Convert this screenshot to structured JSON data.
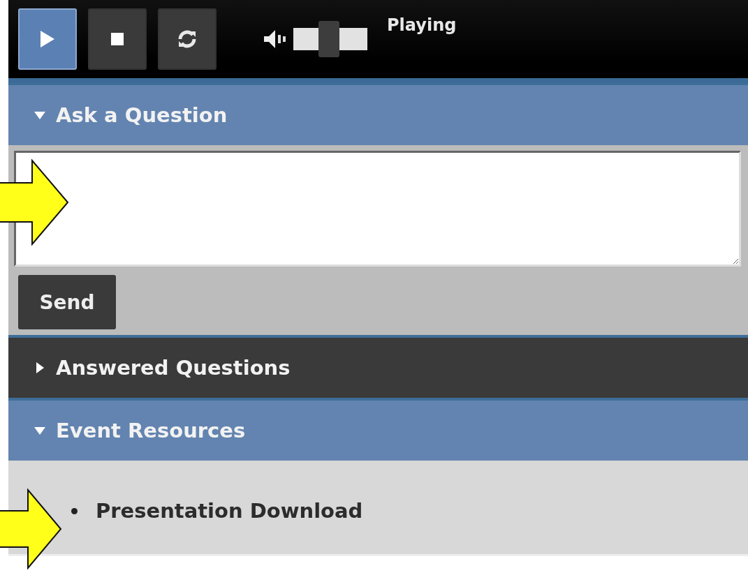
{
  "player": {
    "buttons": [
      {
        "kind": "play",
        "selected": true
      },
      {
        "kind": "stop",
        "selected": false
      },
      {
        "kind": "refresh",
        "selected": false
      }
    ],
    "volume": {
      "level": 0.48
    },
    "status": "Playing"
  },
  "sections": [
    {
      "kind": "question",
      "title": "Ask a Question",
      "expanded": true,
      "send_label": "Send"
    },
    {
      "title": "Answered Questions",
      "expanded": false
    },
    {
      "kind": "list",
      "title": "Event Resources",
      "expanded": true,
      "items": [
        "Presentation Download"
      ]
    }
  ]
}
